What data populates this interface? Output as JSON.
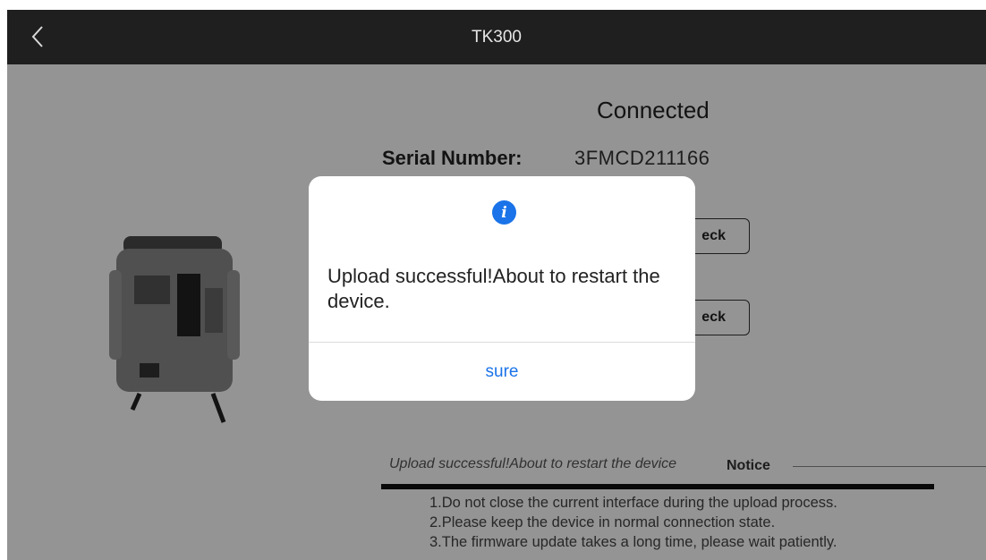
{
  "header": {
    "title": "TK300",
    "back_icon": "chevron-left-icon"
  },
  "device": {
    "status": "Connected",
    "serial_label": "Serial Number:",
    "serial_value": "3FMCD211166",
    "check_button_1": "eck",
    "check_button_2": "eck"
  },
  "upload": {
    "log_text": "Upload successful!About to restart the device",
    "progress": 1.0
  },
  "notice": {
    "title": "Notice",
    "items": [
      "1.Do not close the current interface during the upload process.",
      "2.Please keep the device in normal connection state.",
      "3.The firmware update takes a long time, please wait patiently."
    ]
  },
  "dialog": {
    "icon": "info-icon",
    "icon_glyph": "i",
    "message": "Upload successful!About to restart the device.",
    "confirm_label": "sure"
  },
  "colors": {
    "accent": "#1a73e8",
    "topbar": "#1f1f1f"
  }
}
